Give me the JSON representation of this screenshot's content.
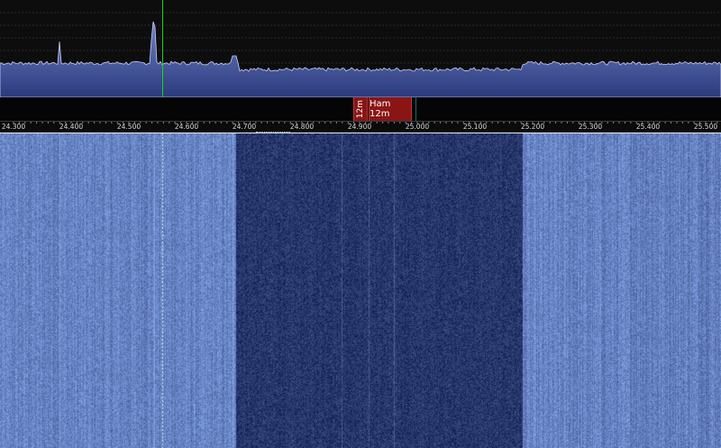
{
  "frequency_scale": {
    "labels": [
      "24.300",
      "24.400",
      "24.500",
      "24.600",
      "24.700",
      "24.800",
      "24.900",
      "25.000",
      "25.100",
      "25.200",
      "25.300",
      "25.400",
      "25.500"
    ]
  },
  "bands": [
    {
      "label": "12m"
    },
    {
      "label": "Ham 12m"
    }
  ],
  "colors": {
    "spectrum_fill": "#4a5ca8",
    "spectrum_line": "#c9cff0",
    "tuning_marker": "#1fd11f",
    "band_tag": "#8b1515",
    "waterfall_low": "#0c1646",
    "waterfall_high": "#6e96ea"
  }
}
